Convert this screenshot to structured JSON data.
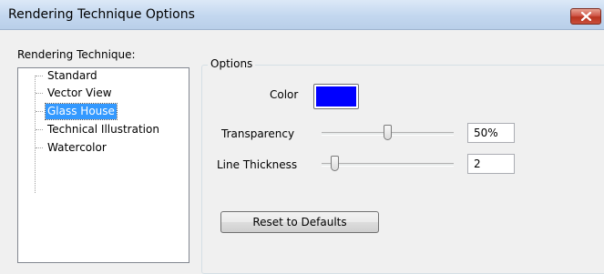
{
  "window": {
    "title": "Rendering Technique Options",
    "close_glyph": "×"
  },
  "technique_label": "Rendering Technique:",
  "techniques": [
    {
      "label": "Standard",
      "selected": false
    },
    {
      "label": "Vector View",
      "selected": false
    },
    {
      "label": "Glass House",
      "selected": true
    },
    {
      "label": "Technical Illustration",
      "selected": false
    },
    {
      "label": "Watercolor",
      "selected": false
    }
  ],
  "options": {
    "legend": "Options",
    "color_label": "Color",
    "color_value": "#0000ff",
    "transparency_label": "Transparency",
    "transparency_value": "50%",
    "transparency_level_fraction": 0.5,
    "line_thickness_label": "Line Thickness",
    "line_thickness_value": "2",
    "line_thickness_level_fraction": 0.1,
    "reset_label": "Reset to Defaults"
  }
}
